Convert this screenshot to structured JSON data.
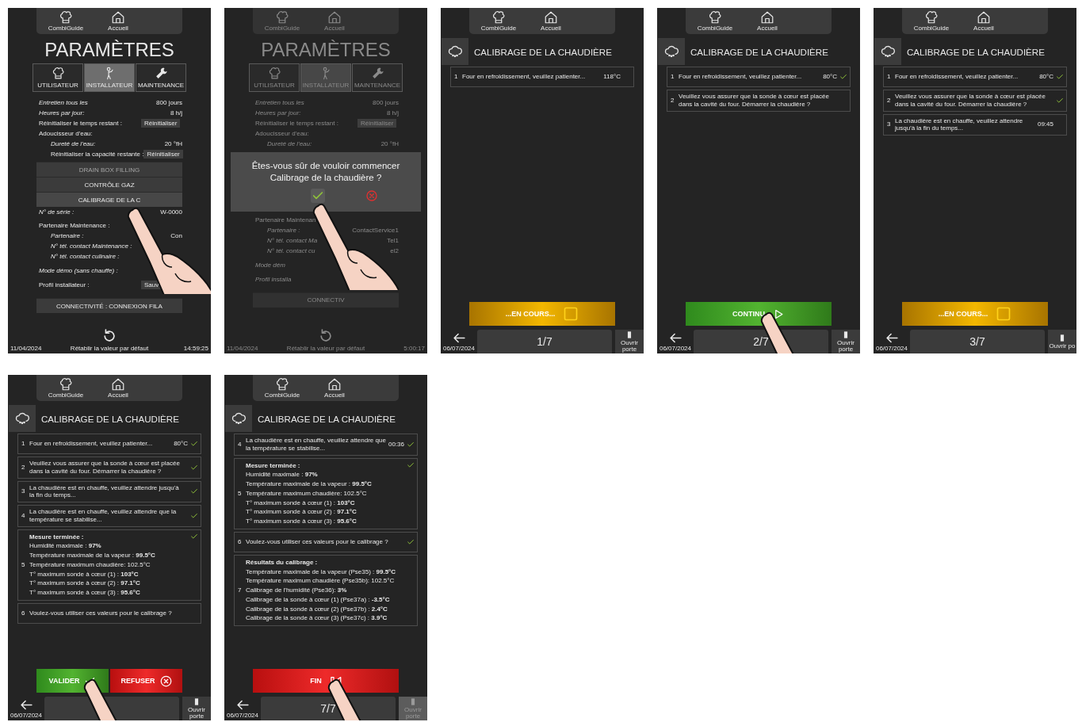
{
  "screens": [
    {
      "kind": "settings",
      "dimmed": false,
      "header": {
        "guide_label": "CombiGuide",
        "home_label": "Accueil"
      },
      "title": "PARAMÈTRES",
      "tabs": [
        {
          "label": "UTILISATEUR",
          "selected": false
        },
        {
          "label": "INSTALLATEUR",
          "selected": true
        },
        {
          "label": "MAINTENANCE",
          "selected": false
        }
      ],
      "rows": [
        {
          "kind": "value",
          "label": "Entretien tous les",
          "value": "800 jours"
        },
        {
          "kind": "value",
          "label": "Heures par jour:",
          "value": "8 h/j"
        },
        {
          "kind": "button",
          "label": "Réinitialiser le temps restant :",
          "button": "Réinitialiser"
        },
        {
          "kind": "heading",
          "label": "Adoucisseur d'eau:",
          "children": [
            {
              "kind": "value",
              "label": "Dureté de l'eau:",
              "value": "20 °fH"
            },
            {
              "kind": "button",
              "label": "Réinitialiser la capacité restante :",
              "button": "Réinitialiser"
            }
          ]
        },
        {
          "kind": "wide_button",
          "label": "DRAIN BOX FILLING",
          "disabled": true,
          "touched": false
        },
        {
          "kind": "wide_button",
          "label": "CONTRÔLE GAZ",
          "disabled": false,
          "touched": false
        },
        {
          "kind": "wide_button",
          "label": "CALIBRAGE DE LA C",
          "disabled": false,
          "touched": true
        },
        {
          "kind": "value",
          "label": "N° de série :",
          "value": "W-0000"
        },
        {
          "kind": "heading",
          "label": "Partenaire Maintenance :",
          "children": [
            {
              "kind": "value",
              "label": "Partenaire :",
              "value": "Con"
            },
            {
              "kind": "value",
              "label": "N° tél. contact Maintenance :"
            },
            {
              "kind": "value",
              "label": "N° tél. contact culinaire :"
            }
          ]
        },
        {
          "kind": "value",
          "label": "Mode démo (sans chauffe) :"
        },
        {
          "kind": "button",
          "label": "Profil installateur :",
          "button": "Sauv"
        },
        {
          "kind": "wide_button",
          "label": "CONNECTIVITÉ : CONNEXION FILA",
          "disabled": false,
          "touched": false
        }
      ],
      "reset_label": "Rétablir la valeur par défaut",
      "date": "11/04/2024",
      "time": "14:59:25"
    },
    {
      "kind": "settings",
      "dimmed": true,
      "header": {
        "guide_label": "CombiGuide",
        "home_label": "Accueil"
      },
      "title": "PARAMÈTRES",
      "tabs": [
        {
          "label": "UTILISATEUR",
          "selected": false
        },
        {
          "label": "INSTALLATEUR",
          "selected": true
        },
        {
          "label": "MAINTENANCE",
          "selected": false
        }
      ],
      "rows": [
        {
          "kind": "value",
          "label": "Entretien tous les",
          "value": "800 jours"
        },
        {
          "kind": "value",
          "label": "Heures par jour:",
          "value": "8 h/j"
        },
        {
          "kind": "button",
          "label": "Réinitialiser le temps restant :",
          "button": "Réinitialiser"
        },
        {
          "kind": "heading",
          "label": "Adoucisseur d'eau:",
          "children": [
            {
              "kind": "value",
              "label": "Dureté de l'eau:",
              "value": "20 °fH"
            }
          ]
        },
        {
          "kind": "dialog",
          "text": "Êtes-vous sûr de vouloir commencer Calibrage de la chaudière ?",
          "touched": true
        },
        {
          "kind": "heading",
          "label": "Partenaire Maintenan",
          "children": [
            {
              "kind": "value",
              "label": "Partenaire :",
              "value": "ContactService1"
            },
            {
              "kind": "value",
              "label": "N° tél. contact Ma",
              "value": "Tel1"
            },
            {
              "kind": "value",
              "label": "N° tél. contact cu",
              "value": "el2"
            }
          ]
        },
        {
          "kind": "value",
          "label": "Mode dém"
        },
        {
          "kind": "value",
          "label": "Profil installa"
        },
        {
          "kind": "wide_button",
          "label": "CONNECTIV",
          "disabled": false,
          "touched": false
        }
      ],
      "reset_label": "Rétablir la valeur par défaut",
      "date": "11/04/2024",
      "time": "5:00:17"
    },
    {
      "kind": "calibration",
      "header": {
        "guide_label": "CombiGuide",
        "home_label": "Accueil"
      },
      "title": "CALIBRAGE DE LA CHAUDIÈRE",
      "steps": [
        {
          "number": "1",
          "text": "Four en refroidissement, veuillez patienter...",
          "value": "118°C",
          "done": false
        }
      ],
      "action": {
        "kind": "progress",
        "label": "...EN COURS...",
        "touched": false
      },
      "date": "06/07/2024",
      "counter": "1/7",
      "door_label": "Ouvrir porte",
      "door_disabled": false
    },
    {
      "kind": "calibration",
      "header": {
        "guide_label": "CombiGuide",
        "home_label": "Accueil"
      },
      "title": "CALIBRAGE DE LA CHAUDIÈRE",
      "steps": [
        {
          "number": "1",
          "text": "Four en refroidissement, veuillez patienter...",
          "value": "80°C",
          "done": true
        },
        {
          "number": "2",
          "text": "Veuillez vous assurer que la sonde à cœur est placée dans la cavité du four. Démarrer la chaudière ?",
          "done": false
        }
      ],
      "action": {
        "kind": "continue",
        "label": "CONTINU",
        "touched": true
      },
      "date": "06/07/2024",
      "counter": "2/7",
      "door_label": "Ouvrir porte",
      "door_disabled": false
    },
    {
      "kind": "calibration",
      "header": {
        "guide_label": "CombiGuide",
        "home_label": "Accueil"
      },
      "title": "CALIBRAGE DE LA CHAUDIÈRE",
      "steps": [
        {
          "number": "1",
          "text": "Four en refroidissement, veuillez patienter...",
          "value": "80°C",
          "done": true
        },
        {
          "number": "2",
          "text": "Veuillez vous assurer que la sonde à cœur est placée dans la cavité du four. Démarrer la chaudière ?",
          "done": true
        },
        {
          "number": "3",
          "text": "La chaudière est en chauffe, veuillez attendre jusqu'à la fin du temps...",
          "value": "09:45",
          "done": false
        }
      ],
      "action": {
        "kind": "progress",
        "label": "...EN COURS...",
        "touched": false
      },
      "date": "06/07/2024",
      "counter": "3/7",
      "door_label": "Ouvrir po",
      "door_disabled": false
    },
    {
      "kind": "calibration",
      "header": {
        "guide_label": "CombiGuide",
        "home_label": "Accueil"
      },
      "title": "CALIBRAGE DE LA CHAUDIÈRE",
      "steps": [
        {
          "number": "1",
          "text": "Four en refroidissement, veuillez patienter...",
          "value": "80°C",
          "done": true
        },
        {
          "number": "2",
          "text": "Veuillez vous assurer que la sonde à cœur est placée dans la cavité du four. Démarrer la chaudière ?",
          "done": true
        },
        {
          "number": "3",
          "text": "La chaudière est en chauffe, veuillez attendre jusqu'à la fin du temps...",
          "done": true
        },
        {
          "number": "4",
          "text": "La chaudière est en chauffe, veuillez attendre que la température se stabilise...",
          "done": true
        },
        {
          "number": "5",
          "heading": "Mesure terminée :",
          "lines": [
            "Humidité maximale : **97%**",
            "Température maximale de la vapeur : **99.5°C**",
            "Température maximum chaudière: 102.5°C",
            "T° maximum sonde à cœur (1) : **103°C**",
            "T° maximum sonde à cœur (2) : **97.1°C**",
            "T° maximum sonde à cœur (3) : **95.6°C**"
          ],
          "done": true
        },
        {
          "number": "6",
          "text": "Voulez-vous utiliser ces valeurs pour le calibrage ?",
          "done": false
        }
      ],
      "action": {
        "kind": "choice",
        "buttons": [
          {
            "kind": "validate",
            "label": "VALIDER",
            "touched": true
          },
          {
            "kind": "refuse",
            "label": "REFUSER",
            "touched": false
          }
        ]
      },
      "date": "06/07/2024",
      "door_label": "Ouvrir porte",
      "door_disabled": false
    },
    {
      "kind": "calibration",
      "header": {
        "guide_label": "CombiGuide",
        "home_label": "Accueil"
      },
      "title": "CALIBRAGE DE LA CHAUDIÈRE",
      "steps": [
        {
          "number": "4",
          "text": "La chaudière est en chauffe, veuillez attendre que la température se stabilise...",
          "value": "00:36",
          "done": true
        },
        {
          "number": "5",
          "heading": "Mesure terminée :",
          "lines": [
            "Humidité maximale : **97%**",
            "Température maximale de la vapeur : **99.5°C**",
            "Température maximum chaudière: 102.5°C",
            "T° maximum sonde à cœur (1) : **103°C**",
            "T° maximum sonde à cœur (2) : **97.1°C**",
            "T° maximum sonde à cœur (3) : **95.6°C**"
          ],
          "done": true
        },
        {
          "number": "6",
          "text": "Voulez-vous utiliser ces valeurs pour le calibrage ?",
          "done": true
        },
        {
          "number": "7",
          "heading": "Résultats du calibrage :",
          "lines": [
            "Température maximale de la vapeur (Pse35) : **99.5°C**",
            "Température maximum chaudière (Pse35b): 102.5°C",
            "Calibrage de l'humidité (Pse36): **3%**",
            "Calibrage de la sonde à cœur (1) (Pse37a) : **-3.5°C**",
            "Calibrage de la sonde à cœur (2) (Pse37b) : **2.4°C**",
            "Calibrage de la sonde à cœur (3) (Pse37c) : **3.9°C**"
          ],
          "done": false
        }
      ],
      "action": {
        "kind": "finish",
        "label": "FIN",
        "touched": true
      },
      "date": "06/07/2024",
      "counter": "7/7",
      "door_label": "Ouvrir porte",
      "door_disabled": true
    }
  ]
}
